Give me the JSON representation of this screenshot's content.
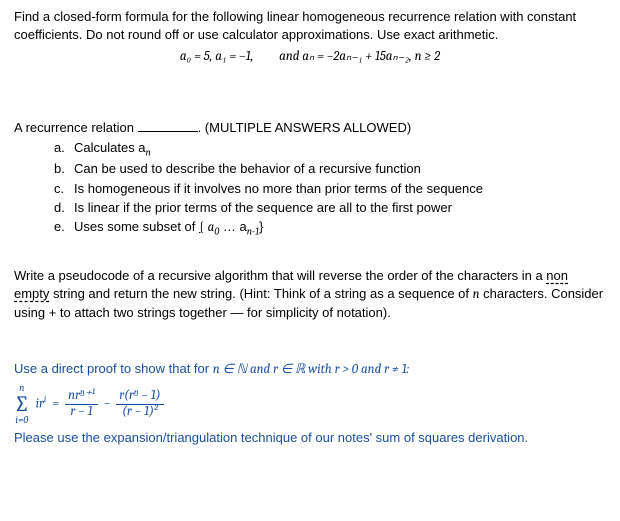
{
  "q1": {
    "prompt": "Find a closed-form formula for the following linear homogeneous recurrence relation with constant coefficients. Do not round off or use calculator approximations. Use exact arithmetic.",
    "math_lhs": "a₀ = 5, a₁ = −1,",
    "math_rhs": "and  aₙ = −2aₙ₋₁ + 15aₙ₋₂, n ≥ 2"
  },
  "q2": {
    "stem_pre": "A recurrence relation ",
    "stem_post": ". (MULTIPLE ANSWERS ALLOWED)",
    "choices": [
      {
        "l": "a.",
        "t": "Calculates a",
        "sub": "n"
      },
      {
        "l": "b.",
        "t": "Can be used to describe the behavior of a recursive function"
      },
      {
        "l": "c.",
        "t": "Is homogeneous if it involves no more than prior terms of the sequence"
      },
      {
        "l": "d.",
        "t": "Is linear if the prior terms of the sequence are all to the first power"
      },
      {
        "l": "e.",
        "t_pre": "Uses some subset of ",
        "set": "{ a",
        "sub0": "0",
        "dots": " … a",
        "sub1": "n-1",
        "close": "}"
      }
    ]
  },
  "q3": {
    "line1_pre": "Write a pseudocode of a recursive algorithm that will reverse the order of the characters in a ",
    "non_empty": "non empty",
    "line1_post": " string and return the new string. (Hint: Think of a string as a sequence of ",
    "n": "n",
    "line2": " characters. Consider using + to attach two strings together — for simplicity of notation)."
  },
  "q4": {
    "intro": "Use a direct proof to show that for ",
    "cond": "n ∈ ℕ and r ∈ ℝ with r > 0 and r ≠ 1:",
    "sigma_top": "n",
    "sigma_bot": "i=0",
    "summand": "ir",
    "summand_sup": "i",
    "eq": " = ",
    "f1_num": "nrⁿ⁺¹",
    "f1_den": "r − 1",
    "minus": " − ",
    "f2_num": "r(rⁿ − 1)",
    "f2_den": "(r − 1)²",
    "note": "Please use the expansion/triangulation technique of our notes' sum of squares derivation."
  }
}
